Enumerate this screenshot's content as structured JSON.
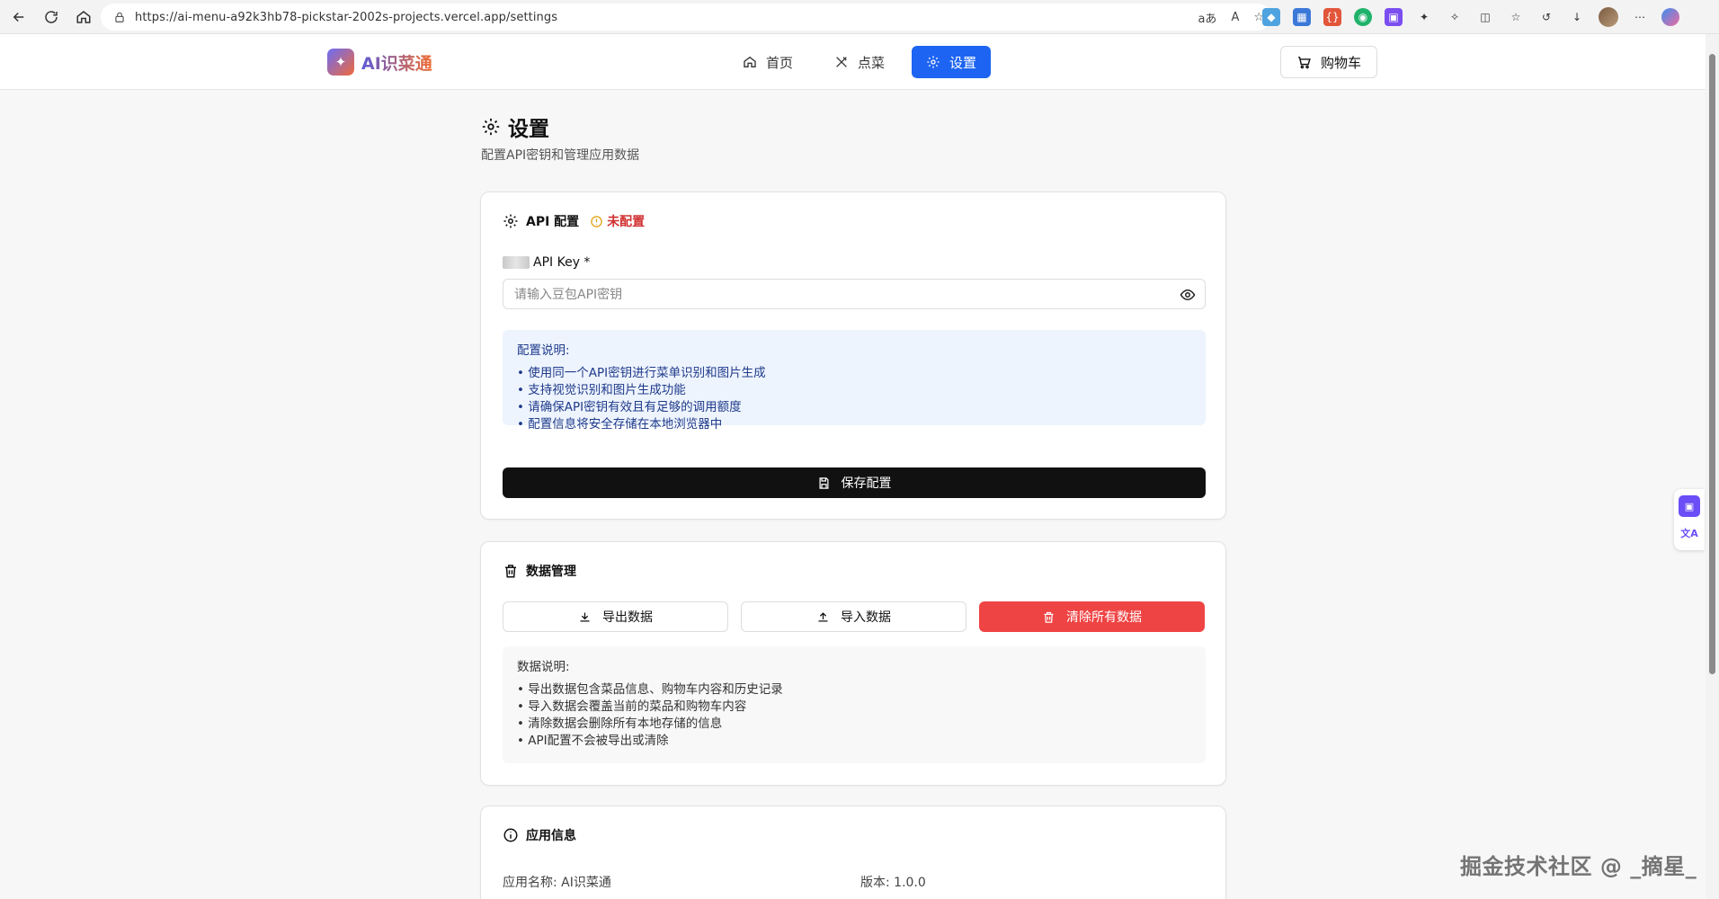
{
  "browser": {
    "url": "https://ai-menu-a92k3hb78-pickstar-2002s-projects.vercel.app/settings",
    "read_aloud_label": "aあ",
    "text_size_label": "A"
  },
  "header": {
    "logo_text": "AI识菜通",
    "nav": [
      {
        "label": "首页",
        "icon": "home-icon"
      },
      {
        "label": "点菜",
        "icon": "utensils-icon"
      },
      {
        "label": "设置",
        "icon": "gear-icon",
        "active": true
      }
    ],
    "cart_label": "购物车"
  },
  "page": {
    "title": "设置",
    "subtitle": "配置API密钥和管理应用数据"
  },
  "api_card": {
    "title": "API 配置",
    "status": "未配置",
    "key_label": "API Key *",
    "key_placeholder": "请输入豆包API密钥",
    "info_title": "配置说明:",
    "info_items": [
      "使用同一个API密钥进行菜单识别和图片生成",
      "支持视觉识别和图片生成功能",
      "请确保API密钥有效且有足够的调用额度",
      "配置信息将安全存储在本地浏览器中"
    ],
    "save_label": "保存配置"
  },
  "data_card": {
    "title": "数据管理",
    "export_label": "导出数据",
    "import_label": "导入数据",
    "clear_label": "清除所有数据",
    "info_title": "数据说明:",
    "info_items": [
      "导出数据包含菜品信息、购物车内容和历史记录",
      "导入数据会覆盖当前的菜品和购物车内容",
      "清除数据会删除所有本地存储的信息",
      "API配置不会被导出或清除"
    ]
  },
  "app_card": {
    "title": "应用信息",
    "name_label": "应用名称:",
    "name_value": "AI识菜通",
    "version_label": "版本:",
    "version_value": "1.0.0"
  },
  "watermark": "掘金技术社区 @ _摘星_",
  "colors": {
    "accent": "#1d64f2",
    "danger": "#ef4444",
    "status_red": "#d03030",
    "save_button": "#111111"
  }
}
